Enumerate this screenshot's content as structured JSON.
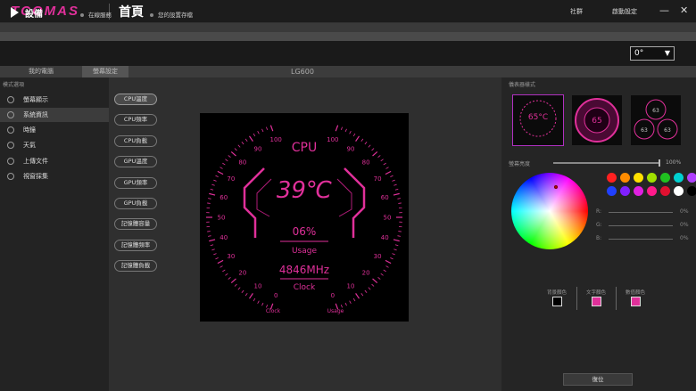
{
  "header": {
    "logo": "TCOMAS",
    "title": "首頁",
    "community": "社群",
    "startup": "啟動設定",
    "minimize": "—",
    "close": "✕"
  },
  "device": {
    "title": "設備",
    "status_online": "在線服務",
    "status_saved": "您的設置存檔",
    "rotation": "0°"
  },
  "tabs": [
    {
      "label": "我的電腦"
    },
    {
      "label": "螢幕設定"
    }
  ],
  "model": "LG600",
  "left_panel": {
    "header": "模式選項",
    "items": [
      {
        "label": "螢幕顯示"
      },
      {
        "label": "系統資訊"
      },
      {
        "label": "時鐘"
      },
      {
        "label": "天氣"
      },
      {
        "label": "上傳文件"
      },
      {
        "label": "視窗採集"
      }
    ]
  },
  "metrics": [
    {
      "label": "CPU溫度"
    },
    {
      "label": "CPU頻率"
    },
    {
      "label": "CPU負載"
    },
    {
      "label": "GPU溫度"
    },
    {
      "label": "GPU頻率"
    },
    {
      "label": "GPU負載"
    },
    {
      "label": "記憶體容量"
    },
    {
      "label": "記憶體頻率"
    },
    {
      "label": "記憶體負載"
    }
  ],
  "gauge": {
    "title": "CPU",
    "temperature": "39℃",
    "usage_value": "06%",
    "usage_label": "Usage",
    "clock_value": "4846MHz",
    "clock_label": "Clock",
    "left_scale": [
      "0",
      "10",
      "20",
      "30",
      "40",
      "50",
      "60",
      "70",
      "80",
      "90",
      "100"
    ],
    "right_scale": [
      "0",
      "10",
      "20",
      "30",
      "40",
      "50",
      "60",
      "70",
      "80",
      "90",
      "100"
    ],
    "left_caption": "Clock",
    "right_caption": "Usage"
  },
  "right_panel": {
    "header": "儀表器樣式",
    "themes": [
      {
        "value": "65°C"
      },
      {
        "value": "65"
      },
      {
        "value_a": "63",
        "value_b": "63",
        "value_c": "63"
      }
    ],
    "brightness_label": "螢幕亮度",
    "brightness_value": "100%",
    "brightness_level": 1.0,
    "swatches": [
      "#ff2020",
      "#ff8c00",
      "#ffe000",
      "#a0e000",
      "#20c020",
      "#00d0d0",
      "#b040ff",
      "#2040ff",
      "#8020ff",
      "#e020e0",
      "#ff1a8c",
      "#e01030",
      "#ffffff",
      "#000000"
    ],
    "r_label": "R:",
    "g_label": "G:",
    "b_label": "B:",
    "r_value": "0%",
    "g_value": "0%",
    "b_value": "0%",
    "color_targets": [
      {
        "label": "背景顏色",
        "color": "#000000"
      },
      {
        "label": "文字顏色",
        "color": "#e0309a"
      },
      {
        "label": "數值顏色",
        "color": "#e0309a"
      }
    ],
    "reset_label": "復位"
  },
  "accent": "#e0309a"
}
